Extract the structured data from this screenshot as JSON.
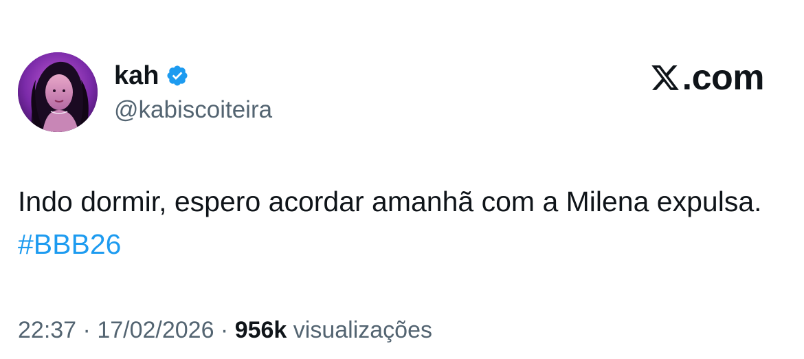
{
  "author": {
    "display_name": "kah",
    "handle": "@kabiscoiteira",
    "verified_icon": "verified-badge-icon",
    "avatar_icon": "avatar-photo"
  },
  "brand": {
    "domain": ".com",
    "logo_icon": "x-logo-icon"
  },
  "tweet": {
    "text": "Indo dormir, espero acordar amanhã com a Milena expulsa.",
    "hashtag": "#BBB26"
  },
  "meta": {
    "time": "22:37",
    "separator_1": " · ",
    "date": "17/02/2026",
    "separator_2": " · ",
    "views_count": "956k",
    "views_label": " visualizações"
  },
  "colors": {
    "text": "#0f1419",
    "secondary": "#536471",
    "hashtag": "#1d9bf0",
    "verified": "#1d9bf0",
    "background": "#ffffff"
  }
}
